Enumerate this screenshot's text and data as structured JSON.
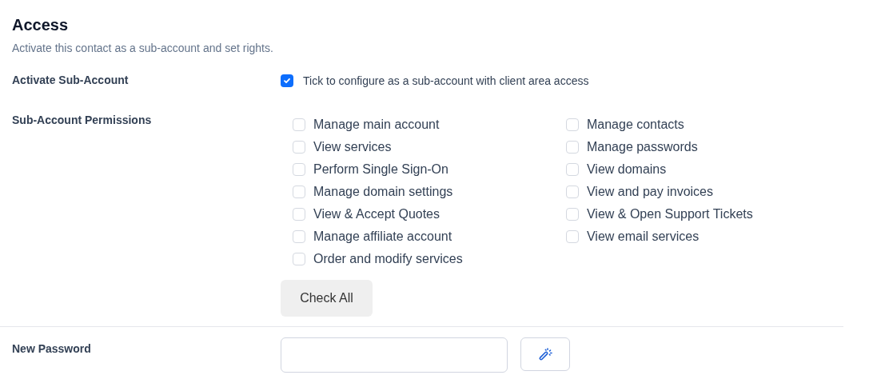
{
  "section": {
    "title": "Access",
    "description": "Activate this contact as a sub-account and set rights."
  },
  "activate": {
    "label": "Activate Sub-Account",
    "checked": true,
    "text": "Tick to configure as a sub-account with client area access"
  },
  "permissions": {
    "label": "Sub-Account Permissions",
    "items": [
      {
        "label": "Manage main account",
        "checked": false
      },
      {
        "label": "View services",
        "checked": false
      },
      {
        "label": "Perform Single Sign-On",
        "checked": false
      },
      {
        "label": "Manage domain settings",
        "checked": false
      },
      {
        "label": "View & Accept Quotes",
        "checked": false
      },
      {
        "label": "Manage affiliate account",
        "checked": false
      },
      {
        "label": "Order and modify services",
        "checked": false
      },
      {
        "label": "Manage contacts",
        "checked": false
      },
      {
        "label": "Manage passwords",
        "checked": false
      },
      {
        "label": "View domains",
        "checked": false
      },
      {
        "label": "View and pay invoices",
        "checked": false
      },
      {
        "label": "View & Open Support Tickets",
        "checked": false
      },
      {
        "label": "View email services",
        "checked": false
      }
    ],
    "button": "Check All"
  },
  "password": {
    "label": "New Password"
  }
}
